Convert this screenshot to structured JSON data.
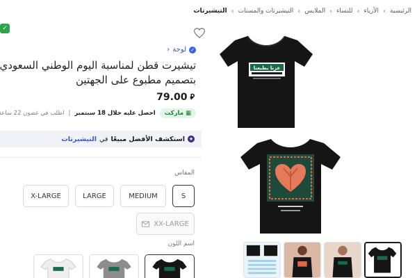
{
  "breadcrumb": {
    "items": [
      "الرئيسية",
      "الأزياء",
      "للنساء",
      "الملابس",
      "التيشيرتات والمسنات",
      "التيشيرتات"
    ]
  },
  "product": {
    "brand": "لوحة",
    "title_line1": "تيشيرت قطن لمناسبة اليوم الوطني السعودي",
    "title_line2": "بتصميم مطبوع على الجهتين",
    "price": "79.00",
    "currency_symbol": "⃁"
  },
  "delivery": {
    "market_label": "ماركت",
    "arrival_text": "احصل عليه خلال 18 سبتمبر",
    "separator": "|",
    "order_window": "اطلب في غضون 22 ساعة 1"
  },
  "explore": {
    "lead": "استكشف الأفضل مبيعًا",
    "in": "في",
    "category": "التيشيرتات"
  },
  "size": {
    "label": "المقاس",
    "options": [
      "S",
      "MEDIUM",
      "LARGE",
      "X-LARGE"
    ],
    "selected": "S",
    "unavailable": "XX-LARGE"
  },
  "color": {
    "label": "اسم اللون"
  },
  "shirt_print": {
    "front_text": "عزنا بطبعنا"
  },
  "colors": {
    "accent_green": "#2ba54a",
    "brand_blue": "#3866df",
    "shirt_black": "#151515"
  }
}
